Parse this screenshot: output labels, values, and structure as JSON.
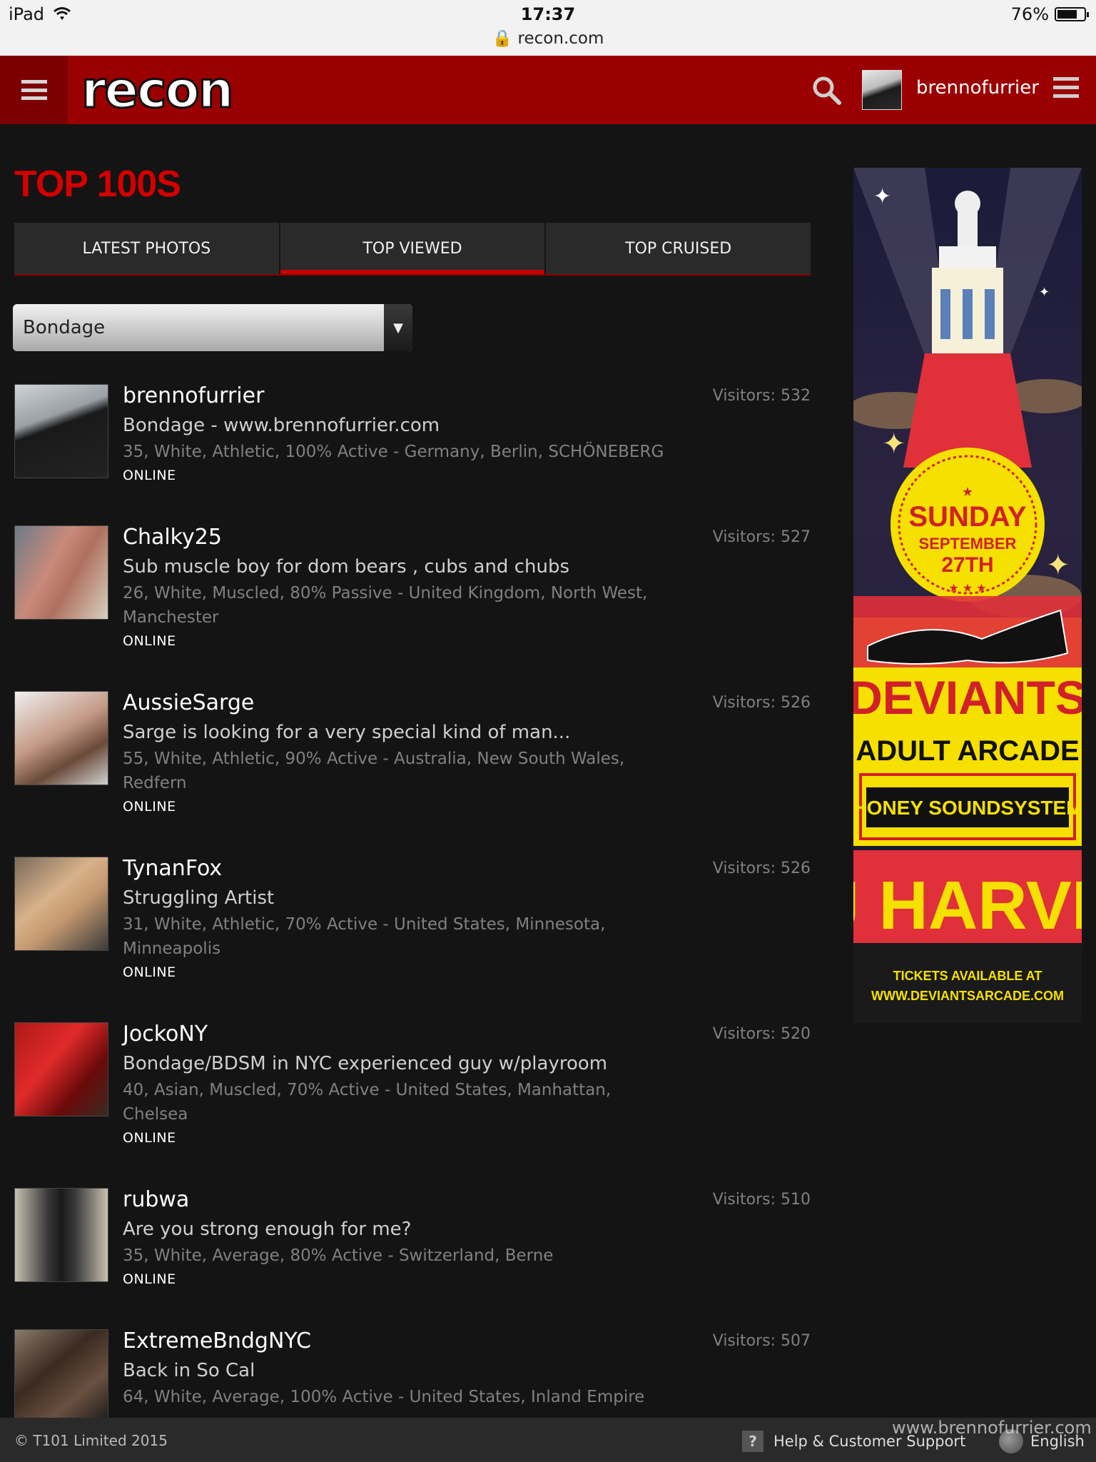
{
  "status_bar": {
    "device": "iPad",
    "time": "17:37",
    "url": "recon.com",
    "battery": "76%",
    "battery_level": 0.76
  },
  "header": {
    "logo": "recon",
    "username": "brennofurrier"
  },
  "page_title": "TOP 100S",
  "tabs": [
    {
      "label": "LATEST PHOTOS",
      "active": false
    },
    {
      "label": "TOP VIEWED",
      "active": true
    },
    {
      "label": "TOP CRUISED",
      "active": false
    }
  ],
  "filter": {
    "selected": "Bondage"
  },
  "profiles": [
    {
      "name": "brennofurrier",
      "tagline": "Bondage - www.brennofurrier.com",
      "details": [
        "35, White, Athletic, 100% Active - Germany, Berlin, SCHÖNEBERG"
      ],
      "status": "ONLINE",
      "visitors": "Visitors: 532"
    },
    {
      "name": "Chalky25",
      "tagline": "Sub muscle boy for dom bears , cubs and chubs",
      "details": [
        "26, White, Muscled, 80% Passive - United Kingdom, North West,",
        "Manchester"
      ],
      "status": "ONLINE",
      "visitors": "Visitors: 527"
    },
    {
      "name": "AussieSarge",
      "tagline": "Sarge is looking for a very special kind of man...",
      "details": [
        "55, White, Athletic, 90% Active - Australia, New South Wales,",
        "Redfern"
      ],
      "status": "ONLINE",
      "visitors": "Visitors: 526"
    },
    {
      "name": "TynanFox",
      "tagline": "Struggling Artist",
      "details": [
        "31, White, Athletic, 70% Active - United States, Minnesota,",
        "Minneapolis"
      ],
      "status": "ONLINE",
      "visitors": "Visitors: 526"
    },
    {
      "name": "JockoNY",
      "tagline": "Bondage/BDSM in NYC experienced guy w/playroom",
      "details": [
        "40, Asian, Muscled, 70% Active - United States, Manhattan,",
        "Chelsea"
      ],
      "status": "ONLINE",
      "visitors": "Visitors: 520"
    },
    {
      "name": "rubwa",
      "tagline": "Are you strong enough for me?",
      "details": [
        "35, White, Average, 80% Active - Switzerland, Berne"
      ],
      "status": "ONLINE",
      "visitors": "Visitors: 510"
    },
    {
      "name": "ExtremeBndgNYC",
      "tagline": "Back in So Cal",
      "details": [
        "64, White, Average, 100% Active - United States, Inland Empire"
      ],
      "status": "",
      "visitors": "Visitors: 507"
    }
  ],
  "ad": {
    "day": "SUNDAY",
    "date_line1": "SEPTEMBER",
    "date_line2": "27TH",
    "title": "DEVIANTS",
    "subtitle": "ADULT ARCADE",
    "sound": "HONEY SOUNDSYSTEM",
    "dj": "DJ HARVEY",
    "tickets_line1": "TICKETS AVAILABLE AT",
    "tickets_line2": "WWW.DEVIANTSARCADE.COM"
  },
  "footer": {
    "copyright": "© T101 Limited 2015",
    "help": "Help & Customer Support",
    "language": "English",
    "watermark": "www.brennofurrier.com"
  },
  "colors": {
    "brand_red": "#9b0000",
    "title_red": "#d40000",
    "background": "#141414"
  }
}
